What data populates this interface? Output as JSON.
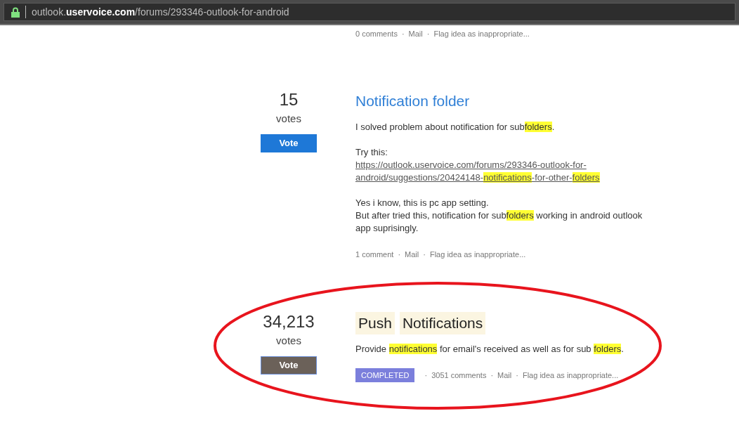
{
  "address_bar": {
    "secure": true,
    "host_prefix": "outlook.",
    "host": "uservoice.com",
    "path": "/forums/293346-outlook-for-android"
  },
  "meta_separator": "·",
  "top_meta": [
    "0 comments",
    "Mail",
    "Flag idea as inappropriate..."
  ],
  "ideas": [
    {
      "votes": "15",
      "votes_label": "votes",
      "vote_button": {
        "label": "Vote",
        "focused": false
      },
      "circled": false,
      "title": [
        {
          "text": "Notification folder",
          "highlighted": false
        }
      ],
      "paragraphs": [
        [
          {
            "link": false,
            "segments": [
              {
                "text": "I solved problem about notification for sub",
                "highlighted": false
              },
              {
                "text": "folders",
                "highlighted": true
              },
              {
                "text": ".",
                "highlighted": false
              }
            ]
          }
        ],
        [
          {
            "link": false,
            "segments": [
              {
                "text": "Try this:",
                "highlighted": false
              }
            ]
          },
          {
            "link": true,
            "segments": [
              {
                "text": "https://outlook.uservoice.com/forums/293346-outlook-for-",
                "highlighted": false
              }
            ]
          },
          {
            "link": true,
            "segments": [
              {
                "text": "android/suggestions/20424148-",
                "highlighted": false
              },
              {
                "text": "notifications",
                "highlighted": true
              },
              {
                "text": "-for-other-",
                "highlighted": false
              },
              {
                "text": "folders",
                "highlighted": true
              }
            ]
          }
        ],
        [
          {
            "link": false,
            "segments": [
              {
                "text": "Yes i know, this is pc app setting.",
                "highlighted": false
              }
            ]
          },
          {
            "link": false,
            "segments": [
              {
                "text": "But after tried this, notification for sub",
                "highlighted": false
              },
              {
                "text": "folders",
                "highlighted": true
              },
              {
                "text": " working in android outlook",
                "highlighted": false
              }
            ]
          },
          {
            "link": false,
            "segments": [
              {
                "text": "app suprisingly.",
                "highlighted": false
              }
            ]
          }
        ]
      ],
      "meta": [
        "1 comment",
        "Mail",
        "Flag idea as inappropriate..."
      ]
    },
    {
      "votes": "34,213",
      "votes_label": "votes",
      "vote_button": {
        "label": "Vote",
        "focused": true
      },
      "circled": true,
      "title": [
        {
          "text": "Push",
          "highlighted": true
        },
        {
          "text": "Notifications",
          "highlighted": true
        }
      ],
      "paragraphs": [
        [
          {
            "link": false,
            "segments": [
              {
                "text": "Provide ",
                "highlighted": false
              },
              {
                "text": "notifications",
                "highlighted": true
              },
              {
                "text": " for email's received as well as for sub ",
                "highlighted": false
              },
              {
                "text": "folders",
                "highlighted": true
              },
              {
                "text": ".",
                "highlighted": false
              }
            ]
          }
        ]
      ],
      "status": "COMPLETED",
      "meta": [
        "3051 comments",
        "Mail",
        "Flag idea as inappropriate..."
      ]
    }
  ]
}
